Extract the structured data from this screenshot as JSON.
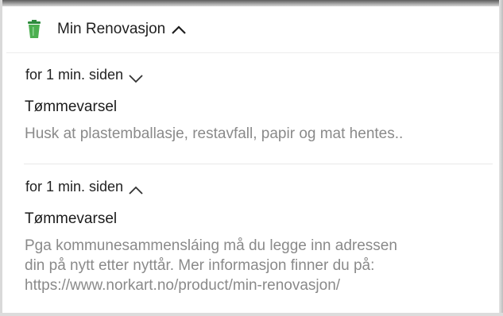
{
  "app": {
    "name": "Min Renovasjon",
    "icon": "green-bin-icon",
    "accent": "#3aa64a"
  },
  "notifications": [
    {
      "time": "for 1 min. siden",
      "expanded": false,
      "title": "Tømmevarsel",
      "body_lines": [
        "Husk at plastemballasje, restavfall, papir og mat hentes.."
      ]
    },
    {
      "time": "for 1 min. siden",
      "expanded": true,
      "title": "Tømmevarsel",
      "body_lines": [
        "Pga kommunesammensláing må du legge inn adressen",
        "din på nytt etter nyttår. Mer informasjon finner du på:",
        "https://www.norkart.no/product/min-renovasjon/"
      ]
    }
  ]
}
